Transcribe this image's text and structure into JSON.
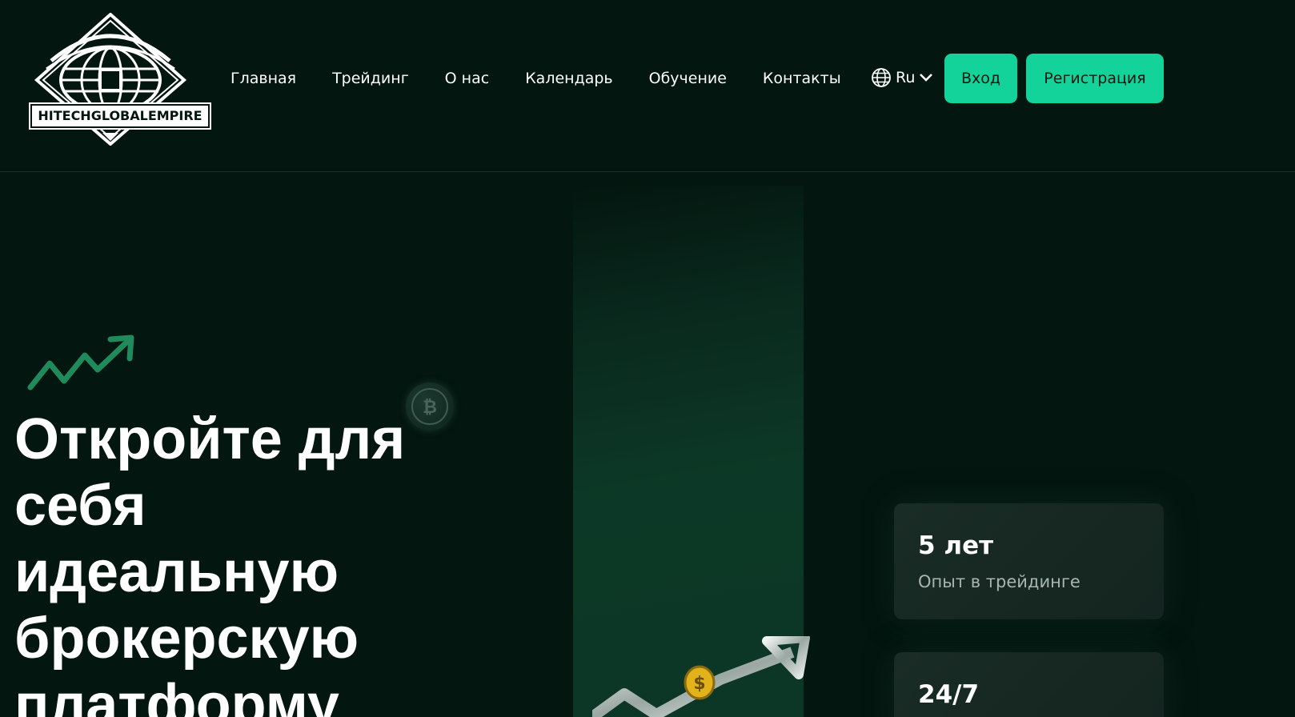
{
  "brand": {
    "logo_text": "HITECHGLOBALEMPIRE",
    "logo_monogram": "H"
  },
  "nav": {
    "items": [
      {
        "label": "Главная"
      },
      {
        "label": "Трейдинг"
      },
      {
        "label": "О нас"
      },
      {
        "label": "Календарь"
      },
      {
        "label": "Обучение"
      },
      {
        "label": "Контакты"
      }
    ],
    "language": "Ru",
    "language_icon": "globe-icon",
    "dropdown_icon": "chevron-down-icon"
  },
  "auth": {
    "login_label": "Вход",
    "register_label": "Регистрация"
  },
  "hero": {
    "title_lines": [
      "Откройте для",
      "себя",
      "идеальную",
      "брокерскую",
      "платформу"
    ],
    "trend_icon": "trend-arrow-icon",
    "coin_icon": "bitcoin-coin-icon"
  },
  "stats": [
    {
      "value": "5 лет",
      "label": "Опыт в трейдинге"
    },
    {
      "value": "24/7",
      "label": ""
    }
  ],
  "colors": {
    "background": "#03160f",
    "accent": "#14d39a",
    "card": "#1a2c26",
    "muted_text": "#a8b5b0",
    "trend_green": "#1f8a5c"
  }
}
